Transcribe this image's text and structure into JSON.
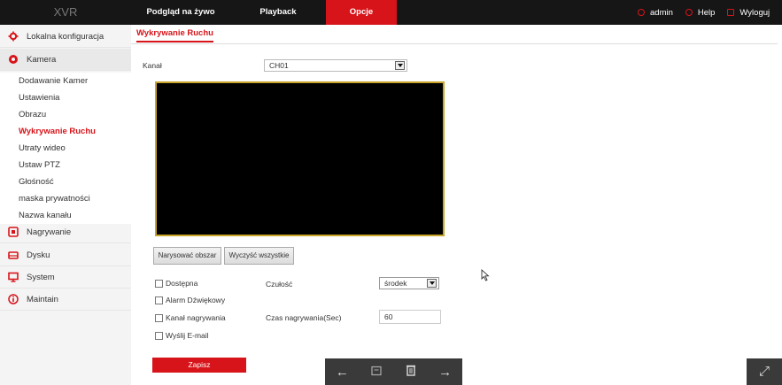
{
  "app": {
    "brand": "XVR"
  },
  "nav": {
    "tabs": [
      "Podgląd na żywo",
      "Playback",
      "Opcje"
    ],
    "active_tab": "Opcje"
  },
  "user_menu": {
    "user": "admin",
    "help": "Help",
    "logout": "Wyloguj"
  },
  "sidebar": {
    "items": [
      {
        "label": "Lokalna konfiguracja",
        "icon": "gear-icon"
      },
      {
        "label": "Kamera",
        "icon": "camera-icon"
      },
      {
        "label": "Nagrywanie",
        "icon": "record-icon"
      },
      {
        "label": "Dysku",
        "icon": "disk-icon"
      },
      {
        "label": "System",
        "icon": "monitor-icon"
      },
      {
        "label": "Maintain",
        "icon": "info-icon"
      }
    ],
    "camera_subitems": [
      "Dodawanie Kamer",
      "Ustawienia",
      "Obrazu",
      "Wykrywanie Ruchu",
      "Utraty wideo",
      "Ustaw PTZ",
      "Głośność",
      "maska prywatności",
      "Nazwa kanału"
    ],
    "active_subitem": "Wykrywanie Ruchu"
  },
  "page": {
    "tab": "Wykrywanie Ruchu",
    "channel_label": "Kanał",
    "channel_value": "CH01",
    "buttons": {
      "draw_area": "Narysować obszar",
      "clear_all": "Wyczyść wszystkie",
      "save": "Zapisz"
    },
    "options": {
      "enabled": "Dostępna",
      "alarm_sound": "Alarm Dźwiękowy",
      "record_channel": "Kanał nagrywania",
      "send_email": "Wyślij E-mail"
    },
    "sensitivity_label": "Czułość",
    "sensitivity_value": "środek",
    "record_time_label": "Czas nagrywania(Sec)",
    "record_time_value": "60"
  },
  "bottom_toolbar": {
    "icons": [
      "arrow-left-icon",
      "window-icon",
      "trash-icon",
      "arrow-right-icon"
    ]
  },
  "colors": {
    "accent": "#d7141a",
    "topbar": "#161616",
    "video_border": "#c9a52a"
  }
}
